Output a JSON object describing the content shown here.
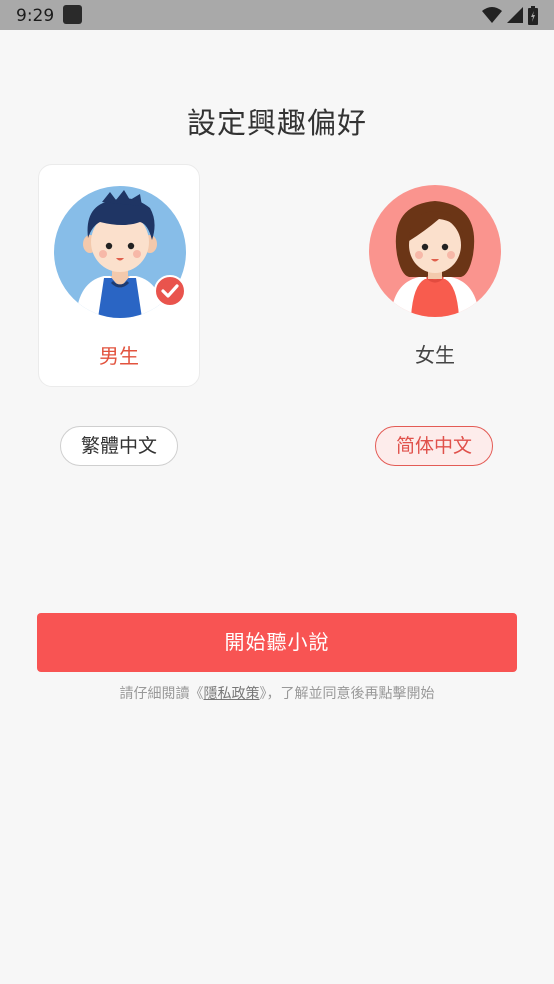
{
  "status_bar": {
    "time": "9:29"
  },
  "page": {
    "title": "設定興趣偏好"
  },
  "genders": [
    {
      "label": "男生",
      "selected": true
    },
    {
      "label": "女生",
      "selected": false
    }
  ],
  "languages": [
    {
      "label": "繁體中文",
      "selected": false
    },
    {
      "label": "简体中文",
      "selected": true
    }
  ],
  "start_button": {
    "label": "開始聽小說"
  },
  "privacy_notice": {
    "prefix": "請仔細閱讀《",
    "link": "隱私政策",
    "suffix": "》，了解並同意後再點擊開始"
  },
  "colors": {
    "accent": "#f85453",
    "selected_text": "#e2533e",
    "background": "#f7f7f7"
  }
}
